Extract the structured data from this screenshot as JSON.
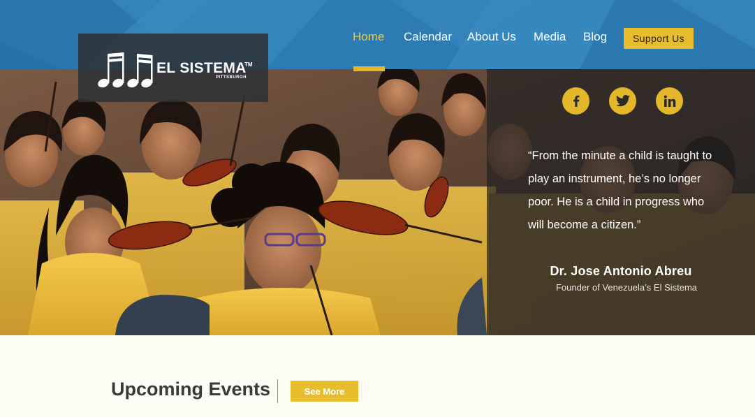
{
  "brand": {
    "name": "EL SISTEMA",
    "trademark": "TM",
    "city": "PITTSBURGH"
  },
  "nav": {
    "items": [
      {
        "label": "Home",
        "active": true
      },
      {
        "label": "Calendar",
        "active": false
      },
      {
        "label": "About Us",
        "active": false
      },
      {
        "label": "Media",
        "active": false
      },
      {
        "label": "Blog",
        "active": false
      }
    ],
    "cta_label": "Support Us"
  },
  "social": [
    {
      "network": "facebook",
      "icon": "facebook-icon",
      "glyph": "f"
    },
    {
      "network": "twitter",
      "icon": "twitter-icon",
      "glyph": ""
    },
    {
      "network": "linkedin",
      "icon": "linkedin-icon",
      "glyph": "in"
    }
  ],
  "quote": {
    "lines": [
      "“From the minute a child is taught to",
      "play an instrument, he’s no longer",
      "poor. He is a child in progress who",
      "will become a citizen.”"
    ],
    "author": "Dr. Jose Antonio Abreu",
    "role": "Founder of Venezuela’s El Sistema"
  },
  "events": {
    "title": "Upcoming Events",
    "see_more_label": "See More"
  },
  "colors": {
    "header_blue": "#2f7fb6",
    "accent_yellow": "#e8bd2d",
    "page_bg": "#fdfcf4"
  }
}
